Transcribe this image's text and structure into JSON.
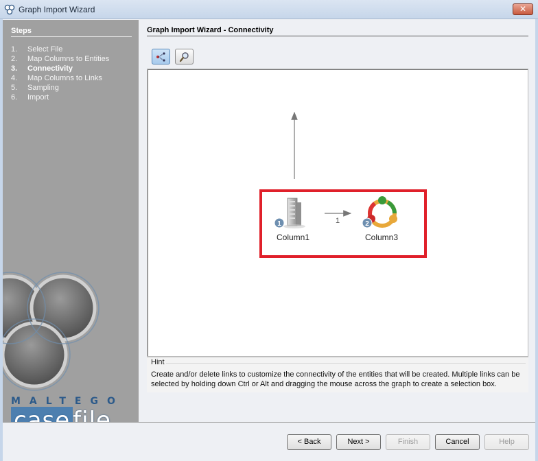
{
  "window": {
    "title": "Graph Import Wizard",
    "close_label": "✕"
  },
  "sidebar": {
    "heading": "Steps",
    "items": [
      {
        "num": "1.",
        "label": "Select File",
        "active": false
      },
      {
        "num": "2.",
        "label": "Map Columns to Entities",
        "active": false
      },
      {
        "num": "3.",
        "label": "Connectivity",
        "active": true
      },
      {
        "num": "4.",
        "label": "Map Columns to Links",
        "active": false
      },
      {
        "num": "5.",
        "label": "Sampling",
        "active": false
      },
      {
        "num": "6.",
        "label": "Import",
        "active": false
      }
    ],
    "brand_top": "MALTEGO",
    "brand_case": "case",
    "brand_file": "file"
  },
  "main": {
    "title": "Graph Import Wizard - Connectivity",
    "toolbar": {
      "connect_icon": "connect-links-icon",
      "zoom_icon": "magnifier-icon"
    },
    "graph": {
      "nodes": [
        {
          "badge": "1",
          "label": "Column1",
          "icon": "building-icon"
        },
        {
          "badge": "2",
          "label": "Column3",
          "icon": "people-circle-icon"
        }
      ],
      "edge_label": "1"
    },
    "hint": {
      "title": "Hint",
      "text": "Create and/or delete links to customize the connectivity of the entities that will be created. Multiple links can be selected by holding down Ctrl or Alt and dragging the mouse across the graph to create a selection box."
    }
  },
  "buttons": {
    "back": "< Back",
    "next": "Next >",
    "finish": "Finish",
    "cancel": "Cancel",
    "help": "Help"
  },
  "colors": {
    "highlight": "#e0202a",
    "sidebar_bg": "#a0a0a0",
    "brand_blue": "#4d7faf"
  }
}
